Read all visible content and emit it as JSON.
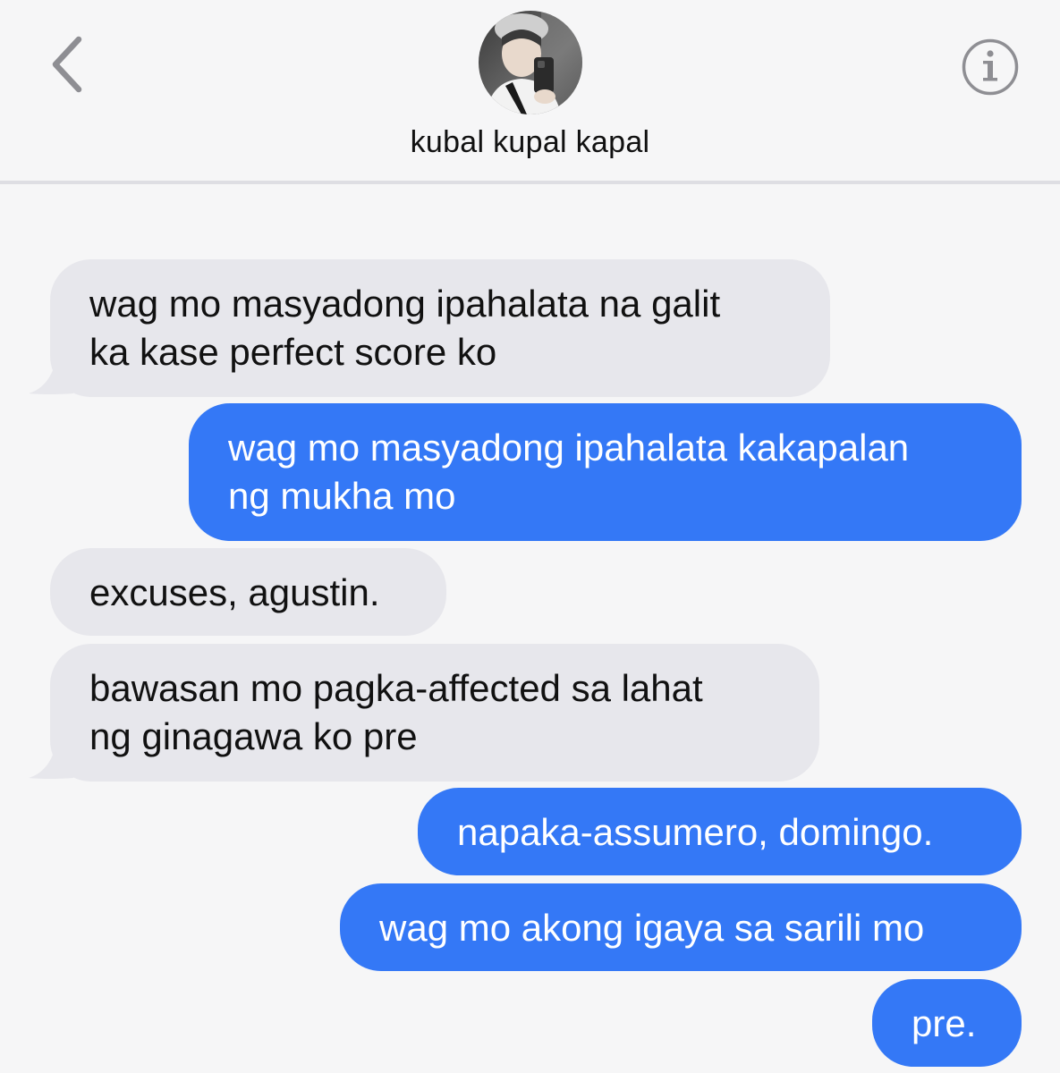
{
  "header": {
    "contact_name": "kubal kupal kapal",
    "back_icon": "chevron-left-icon",
    "info_icon": "info-icon"
  },
  "colors": {
    "background": "#f6f6f7",
    "incoming_bubble": "#e7e7ec",
    "outgoing_bubble": "#3478f6",
    "accent_gray": "#8e8e93"
  },
  "messages": [
    {
      "direction": "incoming",
      "lines": [
        "wag mo masyadong ipahalata na galit",
        "ka kase perfect score ko"
      ]
    },
    {
      "direction": "outgoing",
      "lines": [
        "wag mo masyadong ipahalata kakapalan",
        "ng mukha mo"
      ]
    },
    {
      "direction": "incoming",
      "lines": [
        "excuses, agustin."
      ]
    },
    {
      "direction": "incoming",
      "lines": [
        "bawasan mo pagka-affected sa lahat",
        "ng ginagawa ko pre"
      ]
    },
    {
      "direction": "outgoing",
      "lines": [
        "napaka-assumero, domingo."
      ]
    },
    {
      "direction": "outgoing",
      "lines": [
        "wag mo akong igaya sa sarili mo"
      ]
    },
    {
      "direction": "outgoing",
      "lines": [
        "pre."
      ]
    }
  ]
}
